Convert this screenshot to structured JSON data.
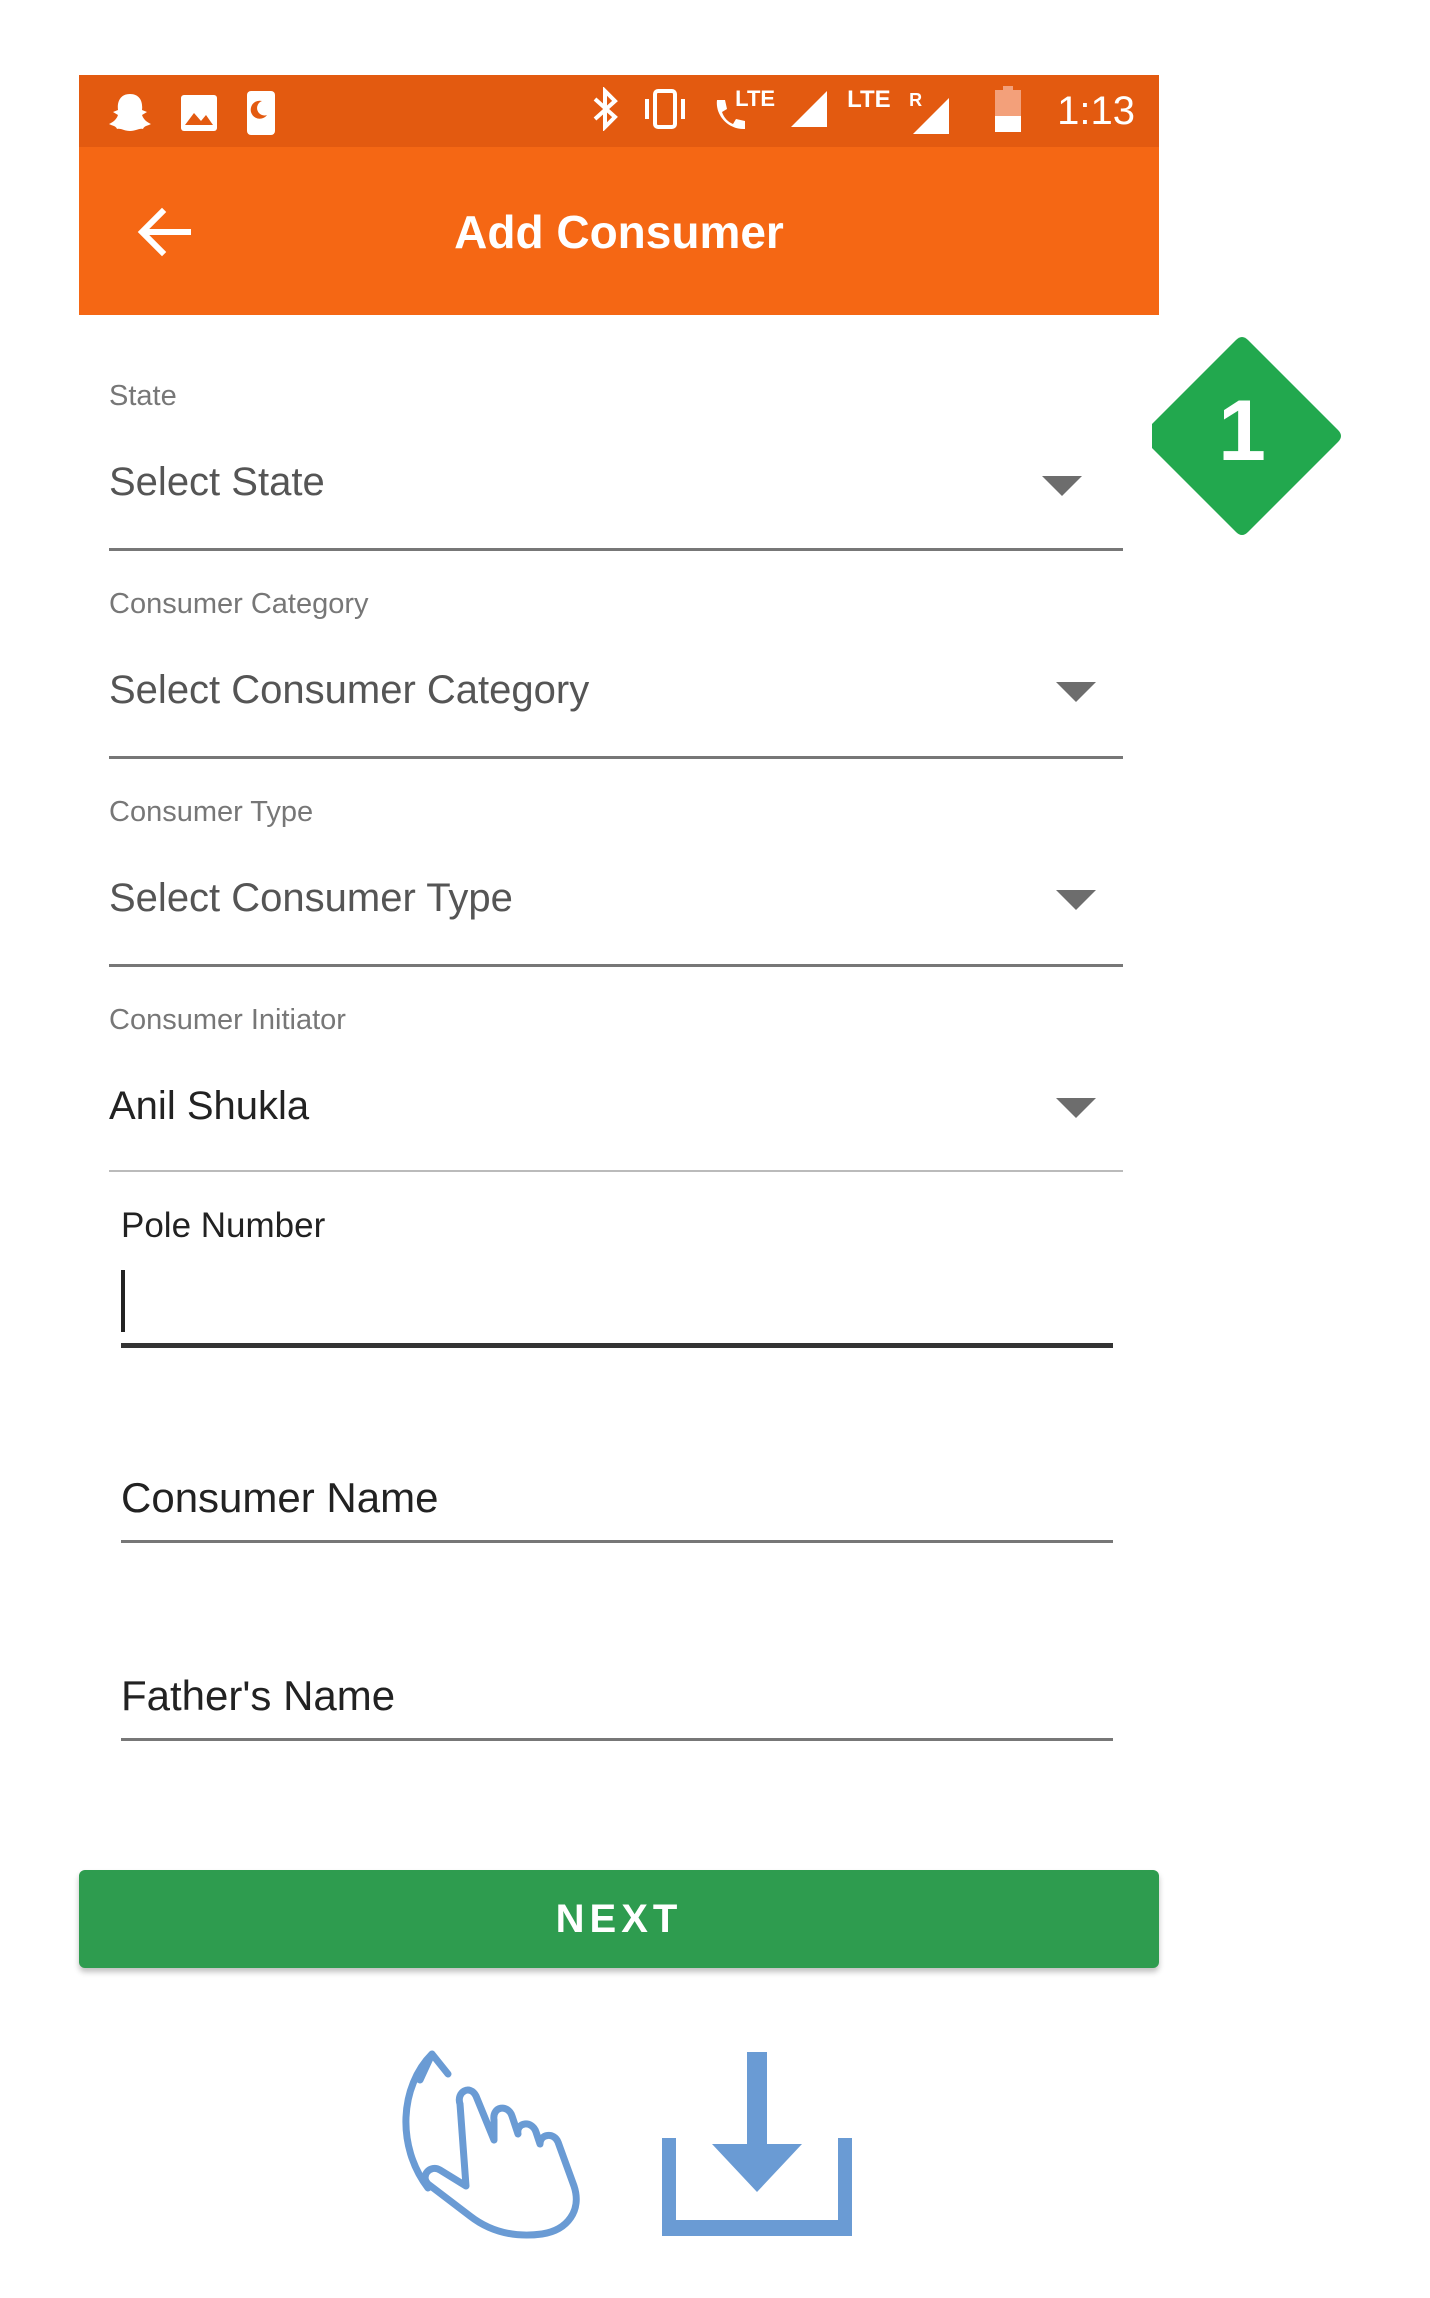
{
  "status_bar": {
    "time": "1:13",
    "lte_1": "LTE",
    "lte_2": "LTE",
    "roaming": "R",
    "icons": [
      "snapchat-icon",
      "image-icon",
      "night-mode-icon",
      "bluetooth-icon",
      "vibrate-icon",
      "volte-call-icon",
      "signal-icon",
      "signal-roaming-icon",
      "battery-low-icon"
    ]
  },
  "app_bar": {
    "title": "Add Consumer",
    "back_icon": "arrow-back-icon"
  },
  "form": {
    "state": {
      "label": "State",
      "value": "Select State"
    },
    "consumer_category": {
      "label": "Consumer Category",
      "value": "Select Consumer Category"
    },
    "consumer_type": {
      "label": "Consumer Type",
      "value": "Select Consumer Type"
    },
    "consumer_initiator": {
      "label": "Consumer Initiator",
      "value": "Anil Shukla"
    },
    "pole_number": {
      "label": "Pole Number",
      "value": ""
    },
    "consumer_name": {
      "placeholder": "Consumer Name"
    },
    "fathers_name": {
      "placeholder": "Father's Name"
    }
  },
  "next_button": "NEXT",
  "annotation": {
    "step": "1"
  },
  "bottom_icons": [
    "tap-gesture-icon",
    "download-icon"
  ],
  "colors": {
    "status_bar": "#e35a10",
    "app_bar": "#f56714",
    "next_button": "#2e9c4f",
    "badge": "#22a84e",
    "bottom_icons": "#6a9bd4"
  }
}
